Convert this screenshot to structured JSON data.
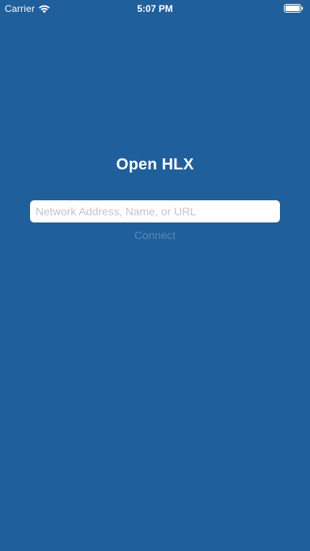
{
  "status_bar": {
    "carrier": "Carrier",
    "time": "5:07 PM",
    "wifi_icon": "wifi-icon",
    "battery_icon": "battery-icon"
  },
  "main": {
    "title": "Open HLX",
    "address_placeholder": "Network Address, Name, or URL",
    "address_value": "",
    "connect_label": "Connect"
  },
  "colors": {
    "background": "#1f5f9c",
    "connect_disabled": "#5f86b3"
  }
}
